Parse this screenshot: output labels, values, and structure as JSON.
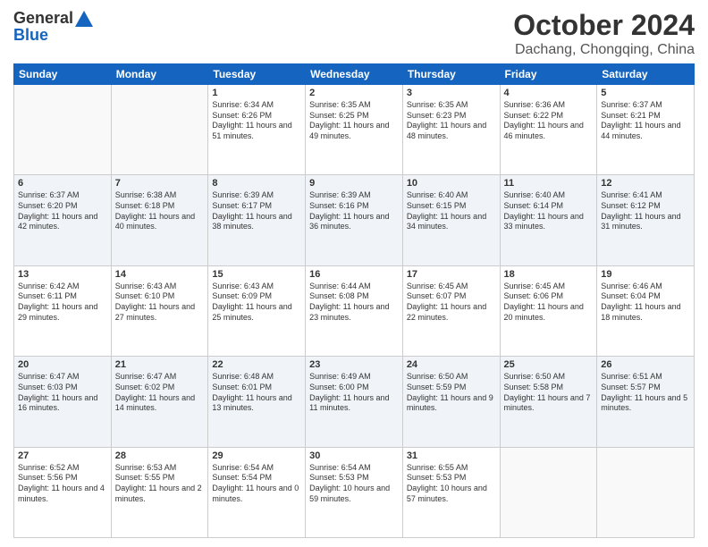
{
  "logo": {
    "general": "General",
    "blue": "Blue"
  },
  "title": "October 2024",
  "location": "Dachang, Chongqing, China",
  "days": [
    "Sunday",
    "Monday",
    "Tuesday",
    "Wednesday",
    "Thursday",
    "Friday",
    "Saturday"
  ],
  "weeks": [
    [
      {
        "day": "",
        "sunrise": "",
        "sunset": "",
        "daylight": ""
      },
      {
        "day": "",
        "sunrise": "",
        "sunset": "",
        "daylight": ""
      },
      {
        "day": "1",
        "sunrise": "Sunrise: 6:34 AM",
        "sunset": "Sunset: 6:26 PM",
        "daylight": "Daylight: 11 hours and 51 minutes."
      },
      {
        "day": "2",
        "sunrise": "Sunrise: 6:35 AM",
        "sunset": "Sunset: 6:25 PM",
        "daylight": "Daylight: 11 hours and 49 minutes."
      },
      {
        "day": "3",
        "sunrise": "Sunrise: 6:35 AM",
        "sunset": "Sunset: 6:23 PM",
        "daylight": "Daylight: 11 hours and 48 minutes."
      },
      {
        "day": "4",
        "sunrise": "Sunrise: 6:36 AM",
        "sunset": "Sunset: 6:22 PM",
        "daylight": "Daylight: 11 hours and 46 minutes."
      },
      {
        "day": "5",
        "sunrise": "Sunrise: 6:37 AM",
        "sunset": "Sunset: 6:21 PM",
        "daylight": "Daylight: 11 hours and 44 minutes."
      }
    ],
    [
      {
        "day": "6",
        "sunrise": "Sunrise: 6:37 AM",
        "sunset": "Sunset: 6:20 PM",
        "daylight": "Daylight: 11 hours and 42 minutes."
      },
      {
        "day": "7",
        "sunrise": "Sunrise: 6:38 AM",
        "sunset": "Sunset: 6:18 PM",
        "daylight": "Daylight: 11 hours and 40 minutes."
      },
      {
        "day": "8",
        "sunrise": "Sunrise: 6:39 AM",
        "sunset": "Sunset: 6:17 PM",
        "daylight": "Daylight: 11 hours and 38 minutes."
      },
      {
        "day": "9",
        "sunrise": "Sunrise: 6:39 AM",
        "sunset": "Sunset: 6:16 PM",
        "daylight": "Daylight: 11 hours and 36 minutes."
      },
      {
        "day": "10",
        "sunrise": "Sunrise: 6:40 AM",
        "sunset": "Sunset: 6:15 PM",
        "daylight": "Daylight: 11 hours and 34 minutes."
      },
      {
        "day": "11",
        "sunrise": "Sunrise: 6:40 AM",
        "sunset": "Sunset: 6:14 PM",
        "daylight": "Daylight: 11 hours and 33 minutes."
      },
      {
        "day": "12",
        "sunrise": "Sunrise: 6:41 AM",
        "sunset": "Sunset: 6:12 PM",
        "daylight": "Daylight: 11 hours and 31 minutes."
      }
    ],
    [
      {
        "day": "13",
        "sunrise": "Sunrise: 6:42 AM",
        "sunset": "Sunset: 6:11 PM",
        "daylight": "Daylight: 11 hours and 29 minutes."
      },
      {
        "day": "14",
        "sunrise": "Sunrise: 6:43 AM",
        "sunset": "Sunset: 6:10 PM",
        "daylight": "Daylight: 11 hours and 27 minutes."
      },
      {
        "day": "15",
        "sunrise": "Sunrise: 6:43 AM",
        "sunset": "Sunset: 6:09 PM",
        "daylight": "Daylight: 11 hours and 25 minutes."
      },
      {
        "day": "16",
        "sunrise": "Sunrise: 6:44 AM",
        "sunset": "Sunset: 6:08 PM",
        "daylight": "Daylight: 11 hours and 23 minutes."
      },
      {
        "day": "17",
        "sunrise": "Sunrise: 6:45 AM",
        "sunset": "Sunset: 6:07 PM",
        "daylight": "Daylight: 11 hours and 22 minutes."
      },
      {
        "day": "18",
        "sunrise": "Sunrise: 6:45 AM",
        "sunset": "Sunset: 6:06 PM",
        "daylight": "Daylight: 11 hours and 20 minutes."
      },
      {
        "day": "19",
        "sunrise": "Sunrise: 6:46 AM",
        "sunset": "Sunset: 6:04 PM",
        "daylight": "Daylight: 11 hours and 18 minutes."
      }
    ],
    [
      {
        "day": "20",
        "sunrise": "Sunrise: 6:47 AM",
        "sunset": "Sunset: 6:03 PM",
        "daylight": "Daylight: 11 hours and 16 minutes."
      },
      {
        "day": "21",
        "sunrise": "Sunrise: 6:47 AM",
        "sunset": "Sunset: 6:02 PM",
        "daylight": "Daylight: 11 hours and 14 minutes."
      },
      {
        "day": "22",
        "sunrise": "Sunrise: 6:48 AM",
        "sunset": "Sunset: 6:01 PM",
        "daylight": "Daylight: 11 hours and 13 minutes."
      },
      {
        "day": "23",
        "sunrise": "Sunrise: 6:49 AM",
        "sunset": "Sunset: 6:00 PM",
        "daylight": "Daylight: 11 hours and 11 minutes."
      },
      {
        "day": "24",
        "sunrise": "Sunrise: 6:50 AM",
        "sunset": "Sunset: 5:59 PM",
        "daylight": "Daylight: 11 hours and 9 minutes."
      },
      {
        "day": "25",
        "sunrise": "Sunrise: 6:50 AM",
        "sunset": "Sunset: 5:58 PM",
        "daylight": "Daylight: 11 hours and 7 minutes."
      },
      {
        "day": "26",
        "sunrise": "Sunrise: 6:51 AM",
        "sunset": "Sunset: 5:57 PM",
        "daylight": "Daylight: 11 hours and 5 minutes."
      }
    ],
    [
      {
        "day": "27",
        "sunrise": "Sunrise: 6:52 AM",
        "sunset": "Sunset: 5:56 PM",
        "daylight": "Daylight: 11 hours and 4 minutes."
      },
      {
        "day": "28",
        "sunrise": "Sunrise: 6:53 AM",
        "sunset": "Sunset: 5:55 PM",
        "daylight": "Daylight: 11 hours and 2 minutes."
      },
      {
        "day": "29",
        "sunrise": "Sunrise: 6:54 AM",
        "sunset": "Sunset: 5:54 PM",
        "daylight": "Daylight: 11 hours and 0 minutes."
      },
      {
        "day": "30",
        "sunrise": "Sunrise: 6:54 AM",
        "sunset": "Sunset: 5:53 PM",
        "daylight": "Daylight: 10 hours and 59 minutes."
      },
      {
        "day": "31",
        "sunrise": "Sunrise: 6:55 AM",
        "sunset": "Sunset: 5:53 PM",
        "daylight": "Daylight: 10 hours and 57 minutes."
      },
      {
        "day": "",
        "sunrise": "",
        "sunset": "",
        "daylight": ""
      },
      {
        "day": "",
        "sunrise": "",
        "sunset": "",
        "daylight": ""
      }
    ]
  ]
}
